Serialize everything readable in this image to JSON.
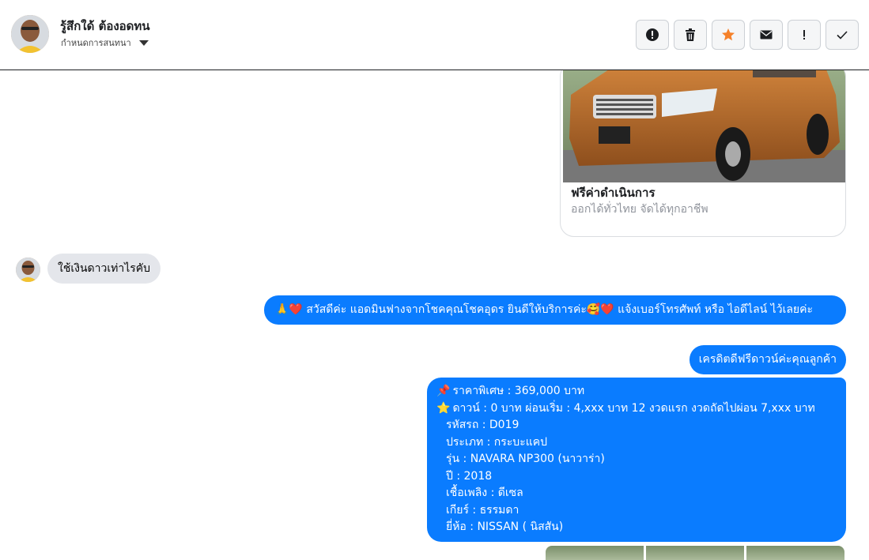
{
  "header": {
    "contact_name": "รู้สึกใด้ ต้องอดทน",
    "contact_sub": "กำหนดการสนทนา",
    "actions": [
      {
        "name": "report-icon",
        "label": "!"
      },
      {
        "name": "trash-icon",
        "label": ""
      },
      {
        "name": "star-icon",
        "label": ""
      },
      {
        "name": "mail-icon",
        "label": ""
      },
      {
        "name": "exclamation-icon",
        "label": "!"
      },
      {
        "name": "check-icon",
        "label": ""
      }
    ],
    "accent_star": "#f5812a"
  },
  "card": {
    "title": "ฟรีค่าดำเนินการ",
    "subtitle": "ออกได้ทั่วไทย จัดได้ทุกอาชีพ"
  },
  "messages": {
    "incoming": "ใช้เงินดาวเท่าไรคับ",
    "out1": "🙏❤️ สวัสดีค่ะ แอดมินฟางจากโชคคุณโชคอุดร ยินดีให้บริการค่ะ🥰❤️ แจ้งเบอร์โทรศัพท์ หรือ ไอดีไลน์  ไว้เลยค่ะ",
    "out2": "เครดิตดีฟรีดาวน์ค่ะคุณลูกค้า",
    "out3": {
      "line1_emoji": "📌",
      "line1": " ราคาพิเศษ : 369,000 บาท",
      "line2_emoji": "⭐",
      "line2": " ดาวน์ : 0 บาท ผ่อนเริ่ม : 4,xxx บาท 12 งวดแรก  งวดถัดไปผ่อน  7,xxx  บาท",
      "line3": "รหัสรถ : D019",
      "line4": "ประเภท : กระบะแคป",
      "line5": "รุ่น : NAVARA NP300 (นาวาร่า)",
      "line6": "ปี : 2018",
      "line7": "เชื้อเพลิง : ดีเซล",
      "line8": "เกียร์ : ธรรมดา",
      "line9": "ยี่ห้อ : NISSAN ( นิสสัน)"
    }
  },
  "colors": {
    "bubble_out": "#0a7cff",
    "bubble_in": "#e4e6eb"
  }
}
